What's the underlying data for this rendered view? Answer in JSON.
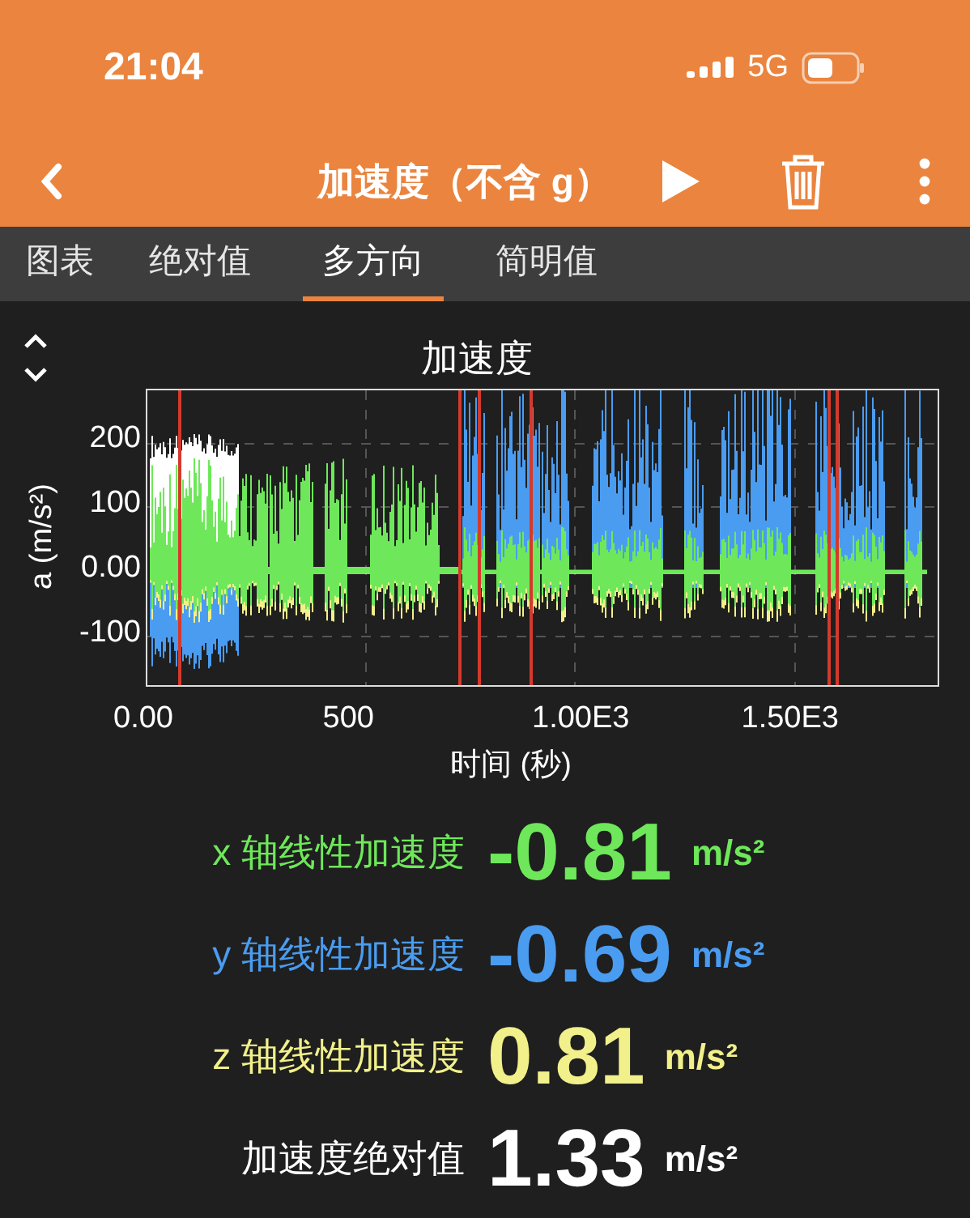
{
  "status_bar": {
    "time": "21:04",
    "network": "5G"
  },
  "toolbar": {
    "title": "加速度（不含 g）"
  },
  "tabs": [
    {
      "label": "图表",
      "selected": false
    },
    {
      "label": "绝对值",
      "selected": false
    },
    {
      "label": "多方向",
      "selected": true
    },
    {
      "label": "简明值",
      "selected": false
    }
  ],
  "graph": {
    "title": "加速度",
    "ylabel": "a (m/s²)",
    "xlabel": "时间 (秒)",
    "yticks": [
      "200",
      "100",
      "0.00",
      "-100"
    ],
    "xticks": [
      "0.00",
      "500",
      "1.00E3",
      "1.50E3"
    ]
  },
  "readouts": [
    {
      "label": "x 轴线性加速度",
      "value": "-0.81",
      "unit": "m/s²",
      "color": "#6ee85a"
    },
    {
      "label": "y 轴线性加速度",
      "value": "-0.69",
      "unit": "m/s²",
      "color": "#4a9cf0"
    },
    {
      "label": "z 轴线性加速度",
      "value": "0.81",
      "unit": "m/s²",
      "color": "#f2f08a"
    },
    {
      "label": "加速度绝对值",
      "value": "1.33",
      "unit": "m/s²",
      "color": "#ffffff"
    }
  ]
}
